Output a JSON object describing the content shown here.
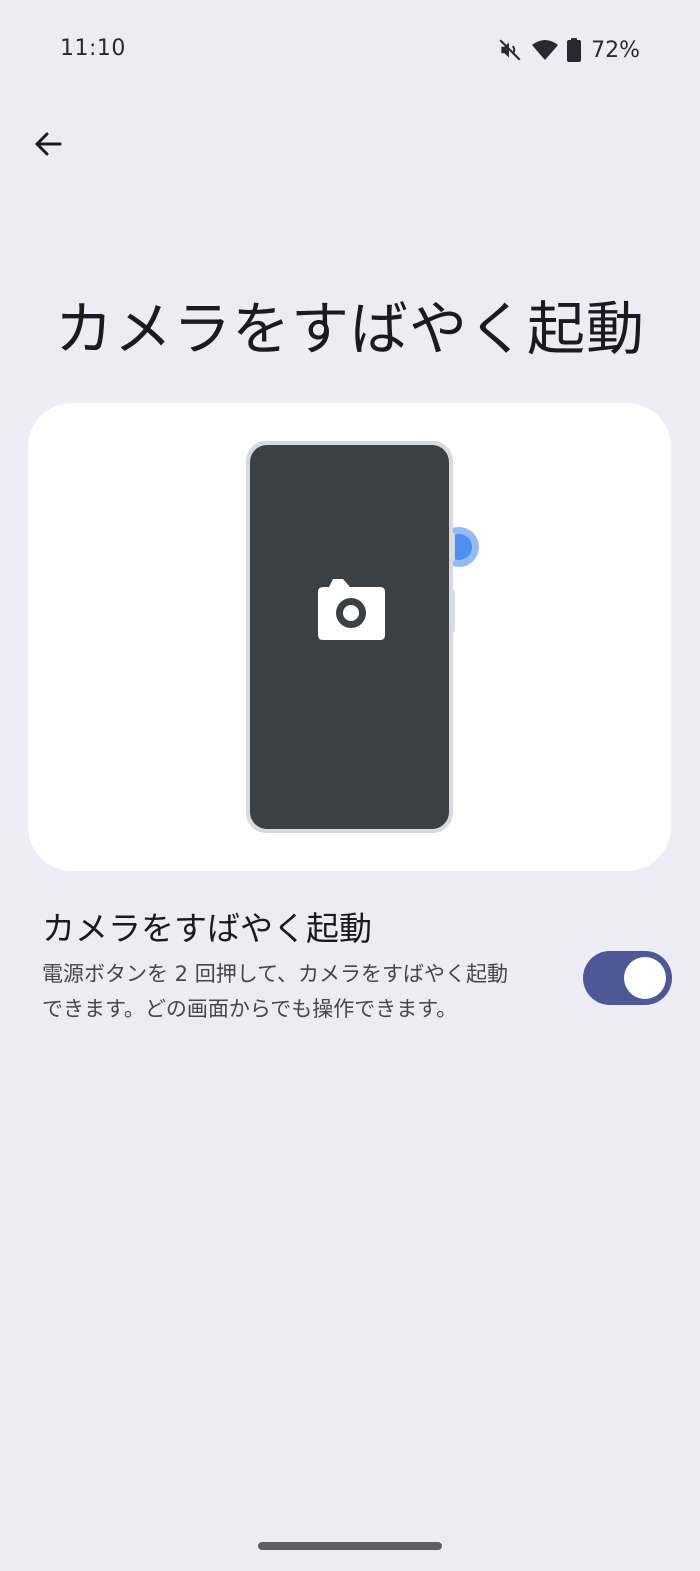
{
  "status_bar": {
    "time": "11:10",
    "battery_percent": "72%",
    "icons": [
      "mute-icon",
      "wifi-icon",
      "battery-icon"
    ]
  },
  "header": {
    "back_icon": "arrow-back-icon"
  },
  "page": {
    "title": "カメラをすばやく起動"
  },
  "illustration": {
    "icon": "camera-icon"
  },
  "setting": {
    "title": "カメラをすばやく起動",
    "summary": "電源ボタンを 2 回押して、カメラをすばやく起動できます。どの画面からでも操作できます。",
    "enabled": true
  },
  "colors": {
    "background": "#edecf4",
    "toggle_track": "#4d5895",
    "accent_blue": "#4d8ef0"
  }
}
